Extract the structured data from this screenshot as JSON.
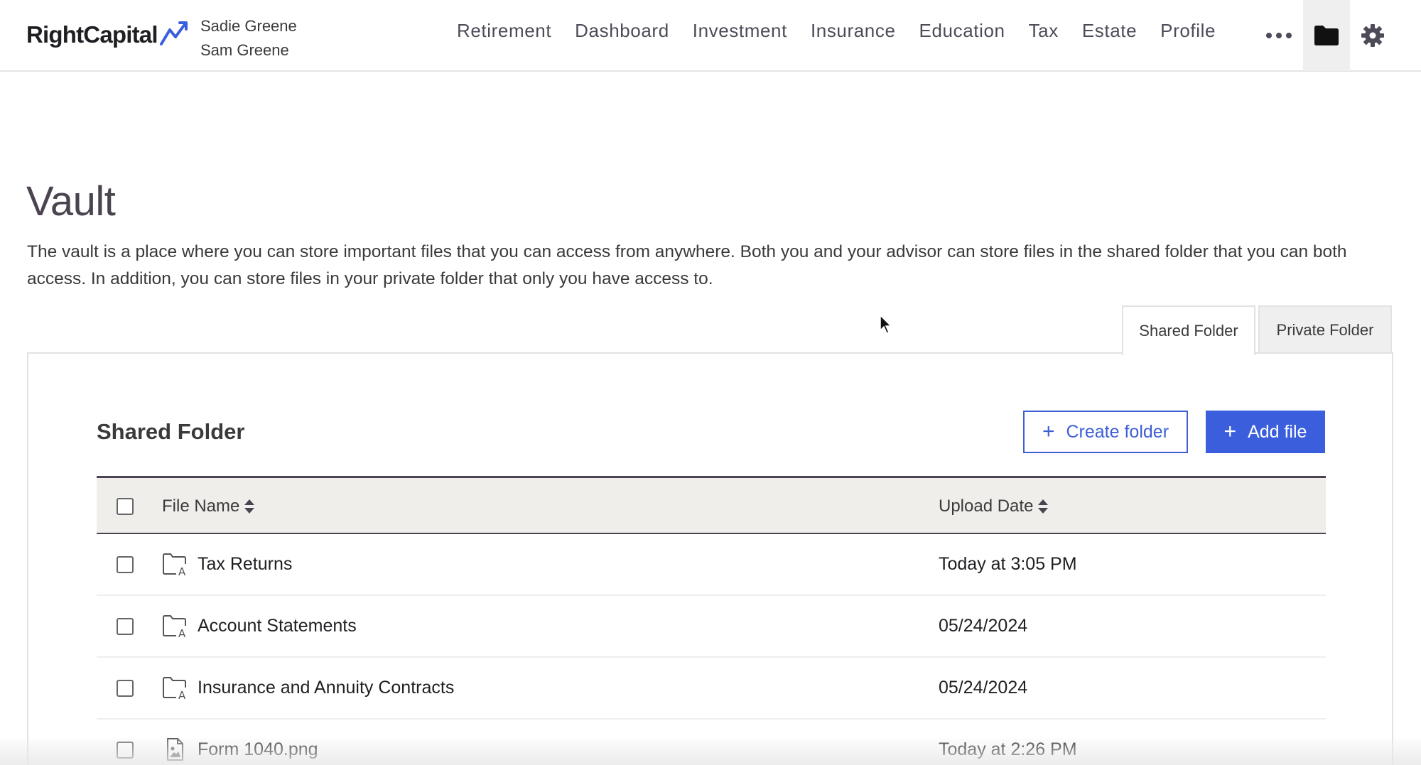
{
  "header": {
    "logo_text": "RightCapital",
    "clients": [
      "Sadie Greene",
      "Sam Greene"
    ],
    "nav": [
      "Retirement",
      "Dashboard",
      "Investment",
      "Insurance",
      "Education",
      "Tax",
      "Estate",
      "Profile"
    ],
    "more_icon": "more-horizontal-icon",
    "folder_icon": "folder-icon",
    "settings_icon": "gear-icon",
    "accent_color": "#3b5fdc"
  },
  "page": {
    "title": "Vault",
    "description": "The vault is a place where you can store important files that you can access from anywhere. Both you and your advisor can store files in the shared folder that you can both access. In addition, you can store files in your private folder that only you have access to."
  },
  "tabs": [
    {
      "label": "Shared Folder",
      "active": true
    },
    {
      "label": "Private Folder",
      "active": false
    }
  ],
  "panel": {
    "title": "Shared Folder",
    "create_folder_label": "Create folder",
    "add_file_label": "Add file"
  },
  "table": {
    "columns": [
      "File Name",
      "Upload Date"
    ],
    "rows": [
      {
        "name": "Tax Returns",
        "date": "Today at 3:05 PM",
        "kind": "advisor-folder-icon"
      },
      {
        "name": "Account Statements",
        "date": "05/24/2024",
        "kind": "advisor-folder-icon"
      },
      {
        "name": "Insurance and Annuity Contracts",
        "date": "05/24/2024",
        "kind": "advisor-folder-icon"
      },
      {
        "name": "Form 1040.png",
        "date": "Today at 2:26 PM",
        "kind": "image-file-icon"
      }
    ]
  }
}
